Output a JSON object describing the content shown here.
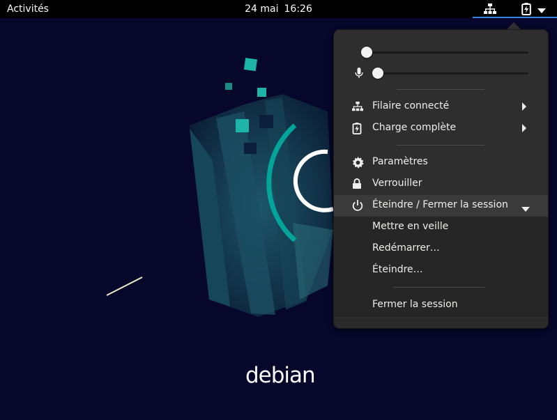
{
  "topbar": {
    "activities": "Activités",
    "date": "24 mai",
    "time": "16:26",
    "accent": "#3584e4",
    "tray_icons": [
      "network-wired-icon",
      "battery-charging-icon",
      "caret-down-icon"
    ]
  },
  "wallpaper": {
    "brand": "debian",
    "swirl_color": "#03a49a",
    "background_color": "#06072a"
  },
  "menu": {
    "volume_level": 0.0,
    "microphone_level": 0.0,
    "network": {
      "label": "Filaire connecté",
      "icon": "network-wired-icon"
    },
    "power": {
      "label": "Charge complète",
      "icon": "battery-charging-icon"
    },
    "settings": {
      "label": "Paramètres",
      "icon": "gear-icon"
    },
    "lock": {
      "label": "Verrouiller",
      "icon": "lock-icon"
    },
    "shutdown_group": {
      "label": "Éteindre / Fermer la session",
      "icon": "power-icon",
      "items": [
        "Mettre en veille",
        "Redémarrer…",
        "Éteindre…"
      ],
      "logout": "Fermer la session"
    }
  }
}
